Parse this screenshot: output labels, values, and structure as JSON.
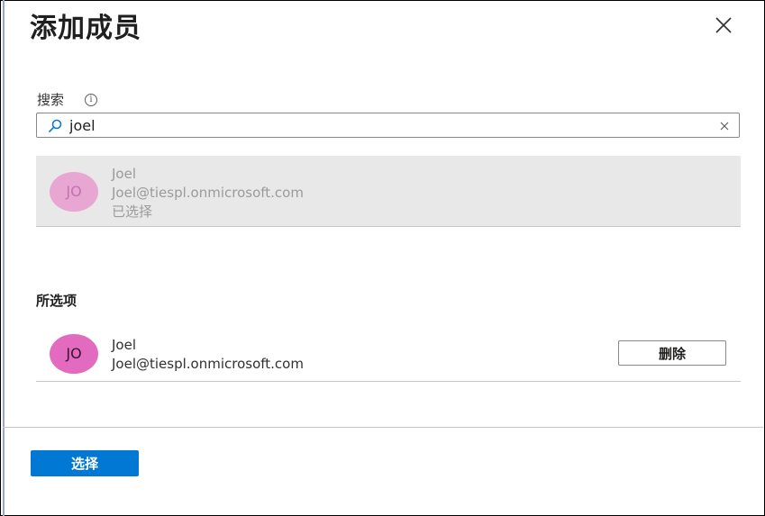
{
  "dialog": {
    "title": "添加成员"
  },
  "search": {
    "label": "搜索",
    "info_glyph": "i",
    "value": "joel",
    "placeholder": ""
  },
  "search_result": {
    "initials": "JO",
    "name": "Joel",
    "email": "Joel@tiespl.onmicrosoft.com",
    "status": "已选择"
  },
  "selected_section": {
    "heading": "所选项",
    "items": [
      {
        "initials": "JO",
        "name": "Joel",
        "email": "Joel@tiespl.onmicrosoft.com",
        "remove_label": "删除"
      }
    ]
  },
  "footer": {
    "select_label": "选择"
  },
  "colors": {
    "primary": "#0078d4",
    "avatar": "#e26bbf",
    "avatar_faded": "#e8a7d3",
    "result_background": "#e8e8e8"
  },
  "icons": [
    "close-icon",
    "info-icon",
    "search-icon",
    "clear-icon"
  ]
}
